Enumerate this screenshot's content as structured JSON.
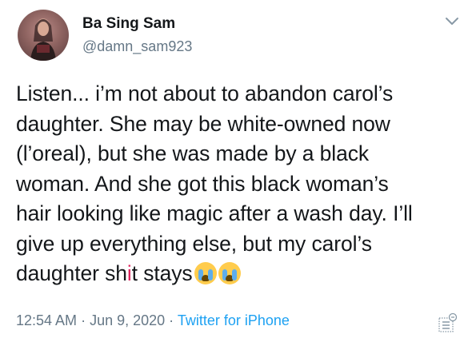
{
  "user": {
    "name": "Ba Sing Sam",
    "handle": "@damn_sam923"
  },
  "tweet": {
    "lines": [
      "Listen... i’m not about to abandon carol’s",
      "daughter. She may be white-owned now",
      "(l’oreal), but she was made by a black",
      "woman. And she got this black woman’s",
      "hair looking like magic after a wash day. I’ll",
      "give up everything else, but my carol’s"
    ],
    "last_line_a": "daughter sh",
    "last_line_censor": "i",
    "last_line_b": "t stays",
    "emojis": [
      "loudly-crying-face-icon",
      "loudly-crying-face-icon"
    ]
  },
  "meta": {
    "time": "12:54 AM",
    "sep1": " · ",
    "date": "Jun 9, 2020",
    "sep2": " · ",
    "source": "Twitter for iPhone"
  },
  "icons": {
    "menu": "chevron-down-icon",
    "analytics": "analytics-icon"
  },
  "colors": {
    "text": "#14171a",
    "secondary": "#657786",
    "link": "#1da1f2",
    "censor": "#e0245e"
  }
}
